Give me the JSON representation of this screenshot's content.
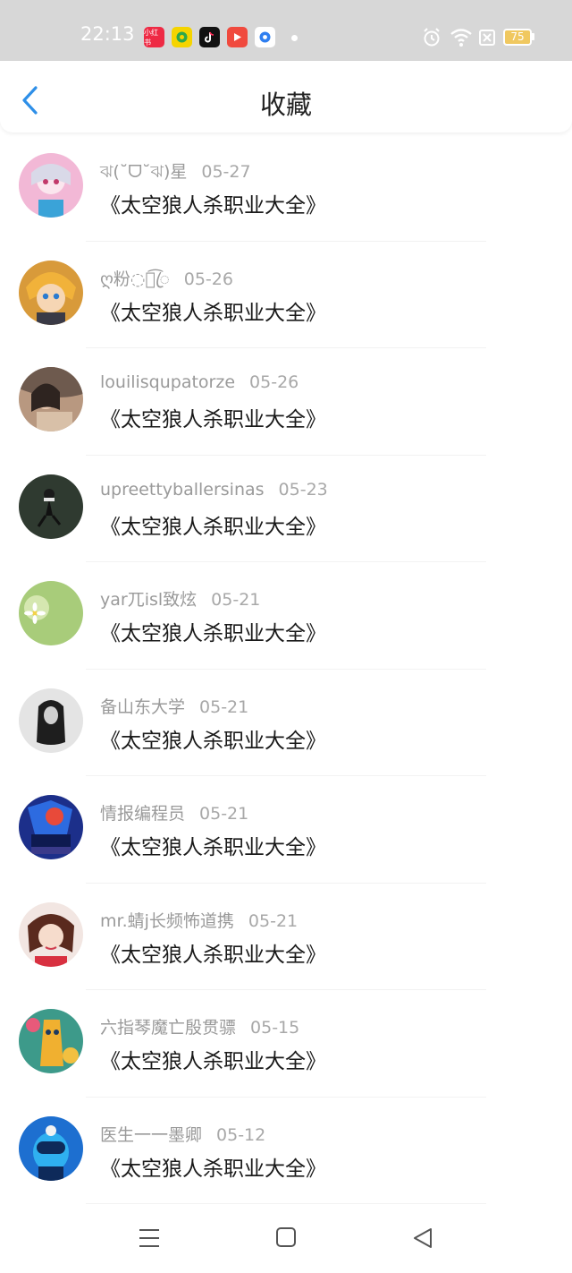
{
  "status_bar": {
    "time": "22:13",
    "battery": "75",
    "apps": [
      {
        "icon": "xiaohongshu-icon",
        "label": "小红书",
        "color": "#ee2a44"
      },
      {
        "icon": "qq-music-icon",
        "label": "",
        "color": "#f5d400"
      },
      {
        "icon": "tiktok-icon",
        "label": "",
        "color": "#111111"
      },
      {
        "icon": "video-app-icon",
        "label": "",
        "color": "#f04a3e"
      },
      {
        "icon": "browser-icon",
        "label": "",
        "color": "#2f7ff0"
      }
    ],
    "icons": [
      "alarm-icon",
      "wifi-icon",
      "sim-off-icon",
      "battery-icon"
    ]
  },
  "header": {
    "title": "收藏",
    "back_icon": "chevron-left-icon",
    "accent": "#2e8fe8"
  },
  "favorites": [
    {
      "user": "ঝ(˘ᗜ˘ঝ)星",
      "date": "05-27",
      "title": "《太空狼人杀职业大全》",
      "avatar_bg": "#f2b8d6"
    },
    {
      "user": "ღ粉◌ใ͡ꦿ",
      "date": "05-26",
      "title": "《太空狼人杀职业大全》",
      "avatar_bg": "#e0a040"
    },
    {
      "user": "louilisqupatorze",
      "date": "05-26",
      "title": "《太空狼人杀职业大全》",
      "avatar_bg": "#6e5a4e"
    },
    {
      "user": "upreettyballersinas",
      "date": "05-23",
      "title": "《太空狼人杀职业大全》",
      "avatar_bg": "#2f3a30"
    },
    {
      "user": "yar兀isl致炫",
      "date": "05-21",
      "title": "《太空狼人杀职业大全》",
      "avatar_bg": "#9cc46a"
    },
    {
      "user": "备山东大学",
      "date": "05-21",
      "title": "《太空狼人杀职业大全》",
      "avatar_bg": "#c8c8c8"
    },
    {
      "user": "情报编程员",
      "date": "05-21",
      "title": "《太空狼人杀职业大全》",
      "avatar_bg": "#2a3fa0"
    },
    {
      "user": "mr.蜻j长频怖道携",
      "date": "05-21",
      "title": "《太空狼人杀职业大全》",
      "avatar_bg": "#d9a69a"
    },
    {
      "user": "六指琴魔亡殷贯骠",
      "date": "05-15",
      "title": "《太空狼人杀职业大全》",
      "avatar_bg": "#3d9a8a"
    },
    {
      "user": "医生一一墨卿",
      "date": "05-12",
      "title": "《太空狼人杀职业大全》",
      "avatar_bg": "#1d6fd0"
    }
  ],
  "nav_bar": {
    "items": [
      "menu-icon",
      "home-square-icon",
      "back-triangle-icon"
    ]
  }
}
